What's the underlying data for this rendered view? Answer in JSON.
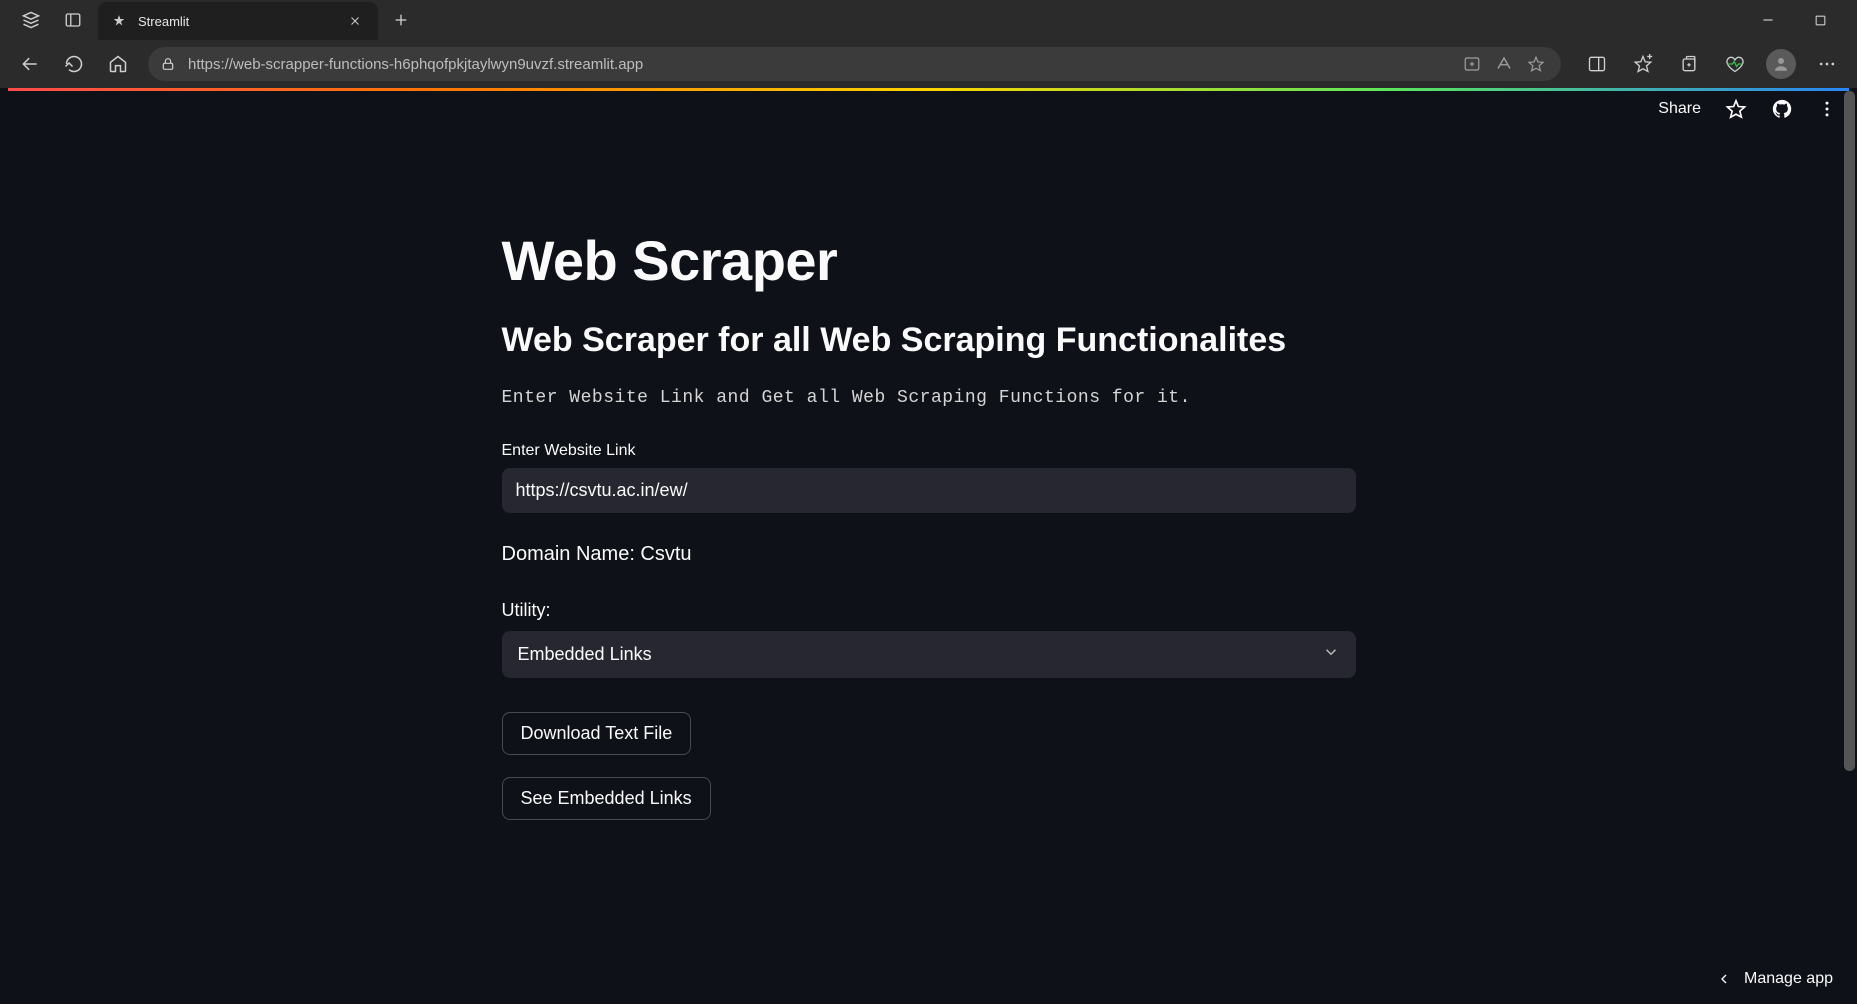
{
  "browser": {
    "tab_title": "Streamlit",
    "url": "https://web-scrapper-functions-h6phqofpkjtaylwyn9uvzf.streamlit.app"
  },
  "topbar": {
    "share": "Share"
  },
  "page": {
    "title": "Web Scraper",
    "subtitle": "Web Scraper for all Web Scraping Functionalites",
    "description": "Enter Website Link and Get all Web Scraping Functions for it.",
    "input_label": "Enter Website Link",
    "input_value": "https://csvtu.ac.in/ew/",
    "domain_line": "Domain Name: Csvtu",
    "utility_label": "Utility:",
    "utility_selected": "Embedded Links",
    "download_btn": "Download Text File",
    "see_links_btn": "See Embedded Links"
  },
  "footer": {
    "manage_app": "Manage app"
  }
}
